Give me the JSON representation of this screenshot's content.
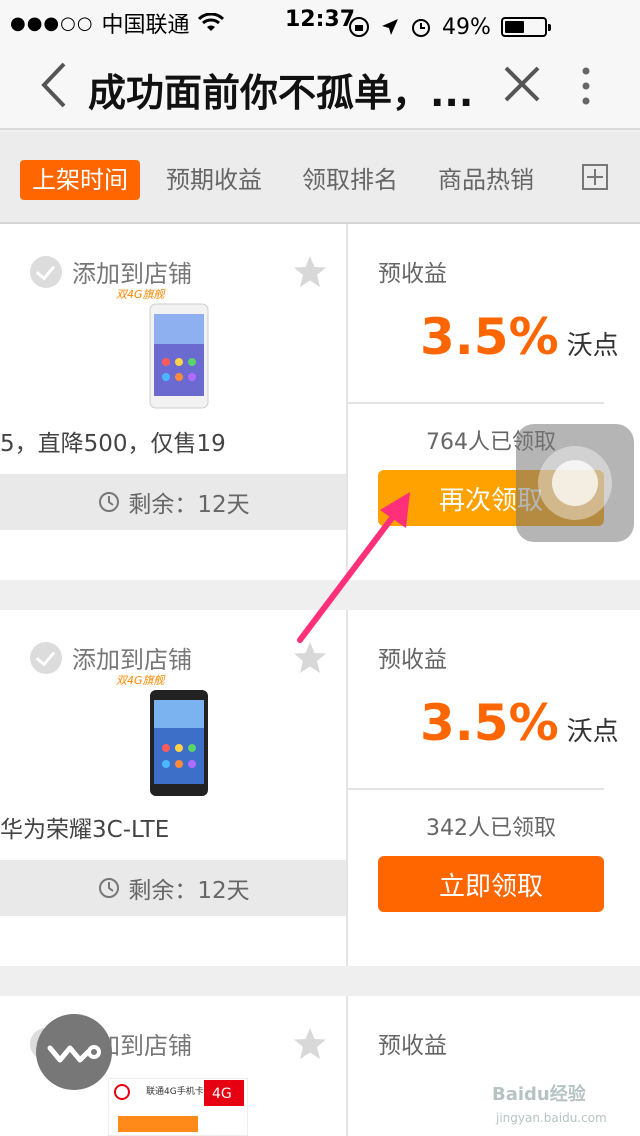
{
  "status_bar": {
    "carrier": "中国联通",
    "time": "12:37",
    "battery": "49%",
    "battery_level": 0.49
  },
  "nav": {
    "title": "成功面前你不孤单，..."
  },
  "tabs": [
    {
      "label": "上架时间",
      "active": true
    },
    {
      "label": "预期收益",
      "active": false
    },
    {
      "label": "领取排名",
      "active": false
    },
    {
      "label": "商品热销",
      "active": false
    }
  ],
  "cards": [
    {
      "add_label": "添加到店铺",
      "name": "5，直降500，仅售19",
      "remain": "剩余：12天",
      "est_label": "预收益",
      "rate": "3.5%",
      "unit": "沃点",
      "claimed": "764人已领取",
      "button": "再次领取",
      "button_color": "#ffa200"
    },
    {
      "add_label": "添加到店铺",
      "name": "华为荣耀3C-LTE",
      "remain": "剩余：12天",
      "est_label": "预收益",
      "rate": "3.5%",
      "unit": "沃点",
      "claimed": "342人已领取",
      "button": "立即领取",
      "button_color": "#ff6600"
    },
    {
      "add_label": "添加到店铺",
      "est_label": "预收益"
    }
  ],
  "product_images": {
    "badge": "双4G旗舰",
    "card_badge": "4G",
    "card_text": "联通4G手机卡"
  },
  "watermark": "Baidu经验",
  "watermark_url": "jingyan.baidu.com",
  "accent_color": "#ff6600"
}
